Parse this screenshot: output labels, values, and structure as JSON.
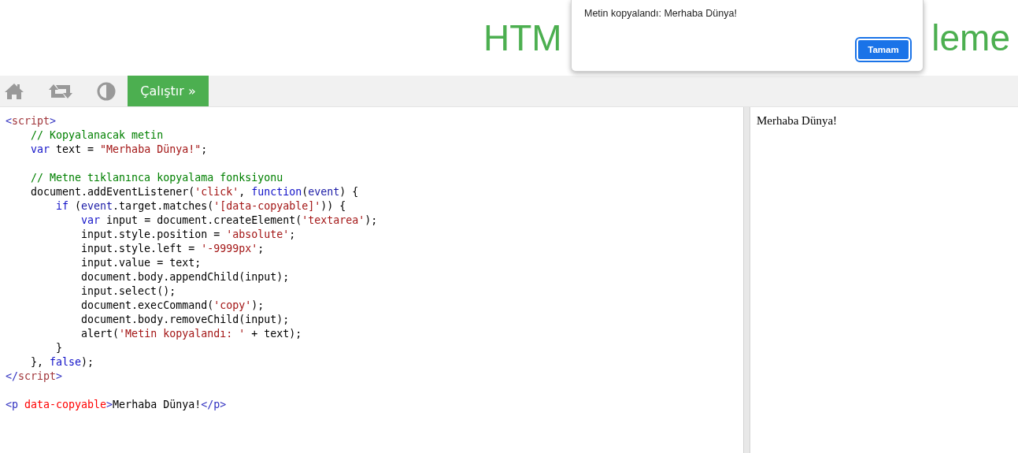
{
  "header": {
    "title_parts": [
      "HTM",
      "leme"
    ]
  },
  "toolbar": {
    "run_button": {
      "label": "Çalıştır »"
    }
  },
  "editor": {
    "lines": [
      {
        "kind": "code",
        "tokens": [
          {
            "kind": "bracket",
            "text": "<"
          },
          {
            "kind": "tag",
            "text": "script"
          },
          {
            "kind": "bracket",
            "text": ">"
          }
        ]
      },
      {
        "kind": "code",
        "tokens": [
          {
            "kind": "comment",
            "text": "    // Kopyalanacak metin"
          }
        ]
      },
      {
        "kind": "code",
        "tokens": [
          {
            "kind": "keyword",
            "text": "    var"
          },
          {
            "kind": "plain",
            "text": " text = "
          },
          {
            "kind": "string",
            "text": "\"Merhaba Dünya!\""
          },
          {
            "kind": "plain",
            "text": ";"
          }
        ]
      },
      {
        "kind": "blank"
      },
      {
        "kind": "code",
        "tokens": [
          {
            "kind": "comment",
            "text": "    // Metne tıklanınca kopyalama fonksiyonu"
          }
        ]
      },
      {
        "kind": "code",
        "tokens": [
          {
            "kind": "plain",
            "text": "    document.addEventListener("
          },
          {
            "kind": "string",
            "text": "'click'"
          },
          {
            "kind": "plain",
            "text": ", "
          },
          {
            "kind": "keyword",
            "text": "function"
          },
          {
            "kind": "plain",
            "text": "("
          },
          {
            "kind": "variable",
            "text": "event"
          },
          {
            "kind": "plain",
            "text": ") {"
          }
        ]
      },
      {
        "kind": "code",
        "tokens": [
          {
            "kind": "keyword",
            "text": "        if"
          },
          {
            "kind": "plain",
            "text": " ("
          },
          {
            "kind": "variable",
            "text": "event"
          },
          {
            "kind": "plain",
            "text": ".target.matches("
          },
          {
            "kind": "string",
            "text": "'[data-copyable]'"
          },
          {
            "kind": "plain",
            "text": ")) {"
          }
        ]
      },
      {
        "kind": "code",
        "tokens": [
          {
            "kind": "keyword",
            "text": "            var"
          },
          {
            "kind": "plain",
            "text": " input = document.createElement("
          },
          {
            "kind": "string",
            "text": "'textarea'"
          },
          {
            "kind": "plain",
            "text": ");"
          }
        ]
      },
      {
        "kind": "code",
        "tokens": [
          {
            "kind": "plain",
            "text": "            input.style.position = "
          },
          {
            "kind": "string",
            "text": "'absolute'"
          },
          {
            "kind": "plain",
            "text": ";"
          }
        ]
      },
      {
        "kind": "code",
        "tokens": [
          {
            "kind": "plain",
            "text": "            input.style.left = "
          },
          {
            "kind": "string",
            "text": "'-9999px'"
          },
          {
            "kind": "plain",
            "text": ";"
          }
        ]
      },
      {
        "kind": "code",
        "tokens": [
          {
            "kind": "plain",
            "text": "            input.value = text;"
          }
        ]
      },
      {
        "kind": "code",
        "tokens": [
          {
            "kind": "plain",
            "text": "            document.body.appendChild(input);"
          }
        ]
      },
      {
        "kind": "code",
        "tokens": [
          {
            "kind": "plain",
            "text": "            input.select();"
          }
        ]
      },
      {
        "kind": "code",
        "tokens": [
          {
            "kind": "plain",
            "text": "            document.execCommand("
          },
          {
            "kind": "string",
            "text": "'copy'"
          },
          {
            "kind": "plain",
            "text": ");"
          }
        ]
      },
      {
        "kind": "code",
        "tokens": [
          {
            "kind": "plain",
            "text": "            document.body.removeChild(input);"
          }
        ]
      },
      {
        "kind": "code",
        "tokens": [
          {
            "kind": "plain",
            "text": "            alert("
          },
          {
            "kind": "string",
            "text": "'Metin kopyalandı: '"
          },
          {
            "kind": "plain",
            "text": " + text);"
          }
        ]
      },
      {
        "kind": "code",
        "tokens": [
          {
            "kind": "plain",
            "text": "        }"
          }
        ]
      },
      {
        "kind": "code",
        "tokens": [
          {
            "kind": "plain",
            "text": "    }, "
          },
          {
            "kind": "keyword",
            "text": "false"
          },
          {
            "kind": "plain",
            "text": ");"
          }
        ]
      },
      {
        "kind": "code",
        "tokens": [
          {
            "kind": "bracket",
            "text": "</"
          },
          {
            "kind": "tag",
            "text": "script"
          },
          {
            "kind": "bracket",
            "text": ">"
          }
        ]
      },
      {
        "kind": "blank"
      },
      {
        "kind": "code",
        "tokens": [
          {
            "kind": "bracket",
            "text": "<p"
          },
          {
            "kind": "attr",
            "text": " data-copyable"
          },
          {
            "kind": "bracket",
            "text": ">"
          },
          {
            "kind": "plain",
            "text": "Merhaba Dünya!"
          },
          {
            "kind": "bracket",
            "text": "</p>"
          }
        ]
      }
    ]
  },
  "result": {
    "text": "Merhaba Dünya!"
  },
  "dialog": {
    "message": "Metin kopyalandı: Merhaba Dünya!",
    "button": "Tamam"
  }
}
